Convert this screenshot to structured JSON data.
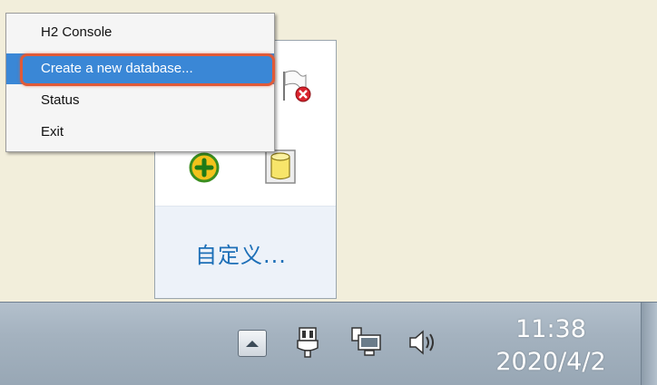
{
  "context_menu": {
    "items": [
      {
        "label": "H2 Console"
      },
      {
        "label": "Create a new database..."
      },
      {
        "label": "Status"
      },
      {
        "label": "Exit"
      }
    ],
    "selected_index": 1
  },
  "tray_overflow": {
    "customize_label": "自定义...",
    "icons": [
      "flag-warning-icon",
      "add-icon",
      "database-icon"
    ]
  },
  "taskbar": {
    "clock": {
      "time": "11:38",
      "date": "2020/4/2"
    },
    "tray_icons": [
      "power-icon",
      "network-icon",
      "volume-icon"
    ]
  },
  "colors": {
    "accent": "#3a87d6",
    "highlight_ring": "#e05a38",
    "link": "#1d6fb7"
  }
}
